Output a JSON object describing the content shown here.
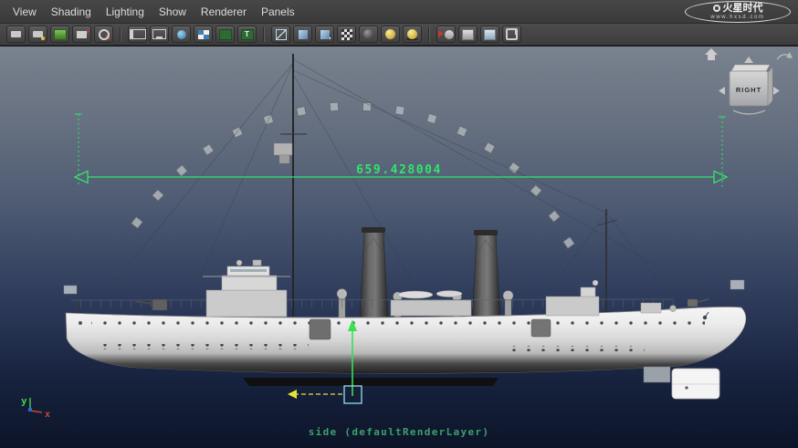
{
  "menu_bar": {
    "items": [
      "View",
      "Shading",
      "Lighting",
      "Show",
      "Renderer",
      "Panels"
    ]
  },
  "logo": {
    "brand": "火星时代",
    "website": "www.hxsd.com"
  },
  "panel_toolbar": {
    "icons": [
      "select-camera-icon",
      "camera-attributes-icon",
      "bookmarks-icon",
      "image-plane-icon",
      "2d-pan-zoom-icon",
      "film-gate-icon",
      "resolution-gate-icon",
      "gate-mask-icon",
      "field-chart-icon",
      "safe-action-icon",
      "safe-title-icon",
      "wireframe-icon",
      "smooth-shade-icon",
      "textured-icon",
      "use-default-material-icon",
      "no-lights-icon",
      "default-light-icon",
      "all-lights-icon",
      "isolate-select-icon",
      "xray-icon",
      "xray-joints-icon",
      "plug-icon"
    ]
  },
  "viewport": {
    "measurement": {
      "value": "659.428004"
    },
    "view_label": "side (defaultRenderLayer)",
    "viewcube": {
      "face": "RIGHT"
    },
    "axis": {
      "up": "y",
      "right": "x"
    },
    "colors": {
      "measurement_green": "#2ee76a",
      "label_green": "#3ea06b",
      "manipulator_green": "#3ae052",
      "manipulator_yellow": "#e6e332"
    }
  }
}
